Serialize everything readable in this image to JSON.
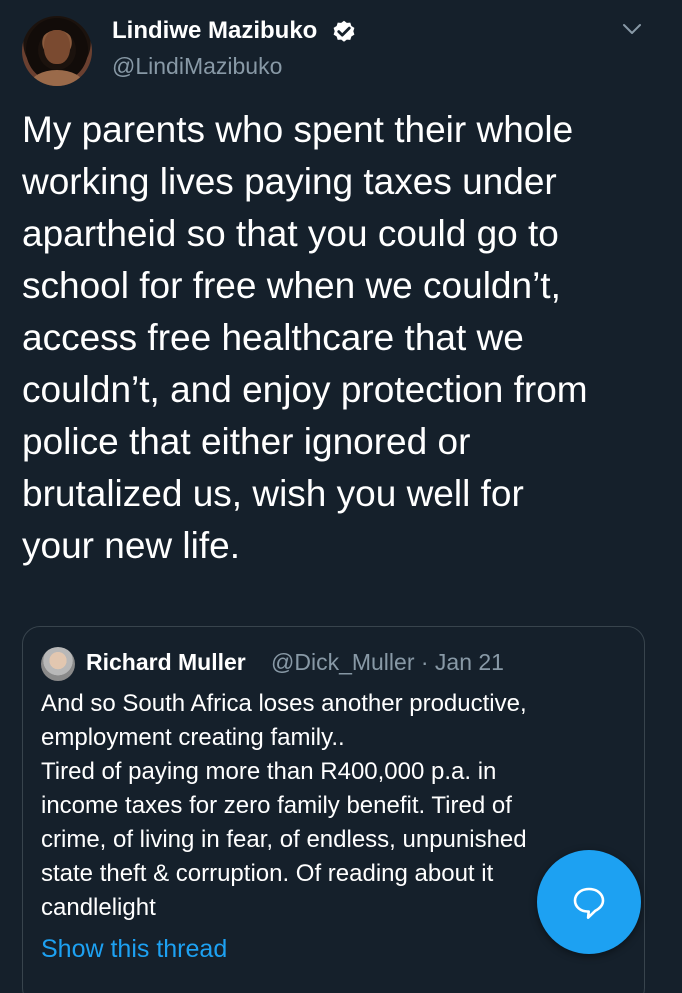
{
  "author": {
    "display_name": "Lindiwe Mazibuko",
    "handle": "@LindiMazibuko",
    "verified_icon": "verified-badge-icon",
    "avatar_icon": "profile-photo"
  },
  "menu": {
    "icon": "chevron-down-icon"
  },
  "tweet": {
    "text": "My parents who spent their whole\nworking lives paying taxes under\napartheid so that you could go to\nschool for free when we couldn’t,\naccess free healthcare that we\ncouldn’t, and enjoy protection from\npolice that either ignored or\nbrutalized us, wish you well for\nyour new life."
  },
  "quoted_tweet": {
    "display_name": "Richard Muller",
    "meta": "@Dick_Muller · Jan 21",
    "text": "And so South Africa loses another productive,\nemployment creating family..\nTired of paying more than R400,000 p.a. in\nincome taxes for zero family benefit. Tired of\ncrime, of living in fear, of endless, unpunished\nstate theft & corruption. Of reading about it\ncandlelight",
    "show_thread": "Show this thread"
  },
  "compose_button": {
    "icon": "compose-reply-icon"
  },
  "colors": {
    "background": "#15202b",
    "accent": "#1da1f2",
    "secondary_text": "#8899a6",
    "border": "#38444d"
  }
}
